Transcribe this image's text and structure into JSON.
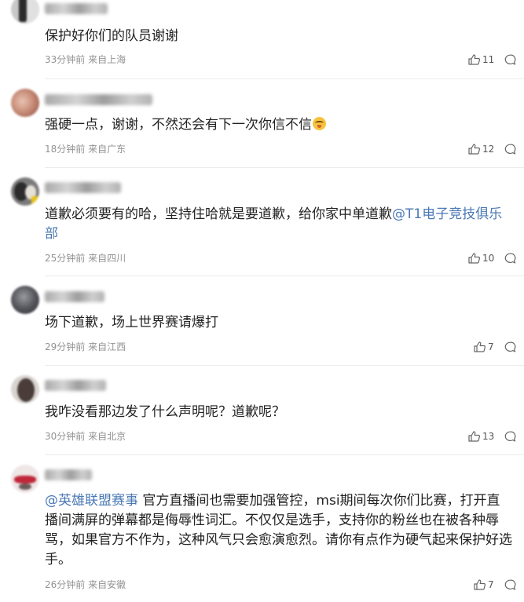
{
  "comments": [
    {
      "text": "保护好你们的队员谢谢",
      "time": "33分钟前",
      "location": "来自上海",
      "likes": "11"
    },
    {
      "text": "强硬一点，谢谢，不然还会有下一次你信不信",
      "time": "18分钟前",
      "location": "来自广东",
      "likes": "12"
    },
    {
      "text": "道歉必须要有的哈，坚持住哈就是要道歉，给你家中单道歉",
      "mention": "@T1电子竞技俱乐部",
      "time": "25分钟前",
      "location": "来自四川",
      "likes": "10"
    },
    {
      "text": "场下道歉，场上世界赛请爆打",
      "time": "29分钟前",
      "location": "来自江西",
      "likes": "7"
    },
    {
      "text": "我咋没看那边发了什么声明呢？道歉呢？",
      "time": "30分钟前",
      "location": "来自北京",
      "likes": "13"
    },
    {
      "mention": "@英雄联盟赛事",
      "text": " 官方直播间也需要加强管控，msi期间每次你们比赛，打开直播间满屏的弹幕都是侮辱性词汇。不仅仅是选手，支持你的粉丝也在被各种辱骂，如果官方不作为，这种风气只会愈演愈烈。请你有点作为硬气起来保护好选手。",
      "time": "26分钟前",
      "location": "来自安徽",
      "likes": "7"
    }
  ],
  "icons": {
    "like": "thumbs-up-icon",
    "reply": "comment-bubble-icon",
    "emoji": "grinning-face-emoji"
  },
  "colors": {
    "mention": "#4a78b4",
    "meta": "#939393",
    "divider": "#ececec"
  }
}
